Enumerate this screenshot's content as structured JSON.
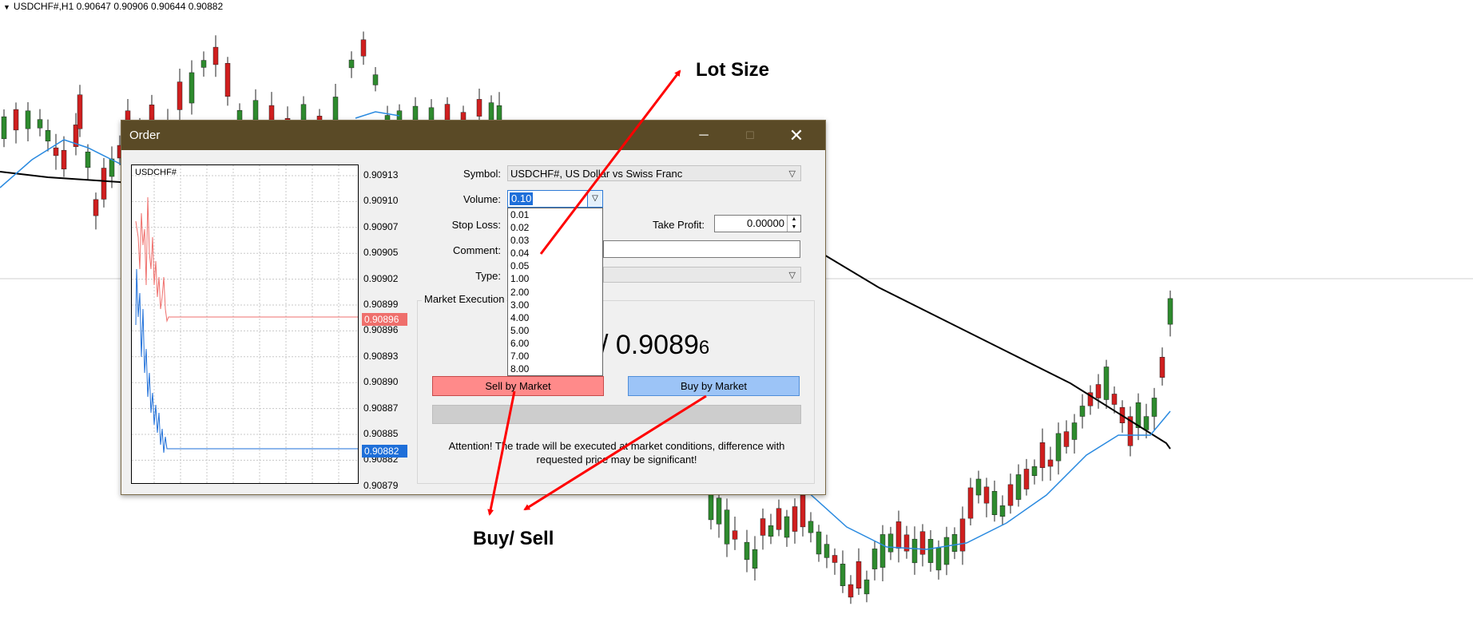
{
  "chart_header": "USDCHF#,H1  0.90647 0.90906 0.90644 0.90882",
  "annotations": {
    "lot_size": "Lot Size",
    "buy_sell": "Buy/ Sell"
  },
  "dialog": {
    "title": "Order",
    "window_buttons": {
      "minimize": "─",
      "maximize": "☐",
      "close": "✕"
    },
    "mini_chart": {
      "symbol": "USDCHF#",
      "ticks": [
        "0.90913",
        "0.90910",
        "0.90907",
        "0.90905",
        "0.90902",
        "0.90899",
        "0.90896",
        "0.90893",
        "0.90890",
        "0.90887",
        "0.90885",
        "0.90882",
        "0.90879"
      ],
      "sell_tag": "0.90896",
      "buy_tag": "0.90882"
    },
    "form": {
      "symbol_label": "Symbol:",
      "symbol_value": "USDCHF#, US Dollar vs Swiss Franc",
      "volume_label": "Volume:",
      "volume_value": "0.10",
      "volume_options": [
        "0.01",
        "0.02",
        "0.03",
        "0.04",
        "0.05",
        "1.00",
        "2.00",
        "3.00",
        "4.00",
        "5.00",
        "6.00",
        "7.00",
        "8.00"
      ],
      "stop_loss_label": "Stop Loss:",
      "take_profit_label": "Take Profit:",
      "take_profit_value": "0.00000",
      "comment_label": "Comment:",
      "type_label": "Type:"
    },
    "execution": {
      "group_title": "Market Execution",
      "price_main": "/ 0.9089",
      "price_small": "6",
      "sell_button": "Sell by Market",
      "buy_button": "Buy by Market",
      "attention": "Attention! The trade will be executed at market conditions, difference with requested price may be significant!"
    }
  },
  "colors": {
    "titlebar": "#5a4a26",
    "sell": "#ff8a8a",
    "buy": "#9cc4f7",
    "arrow": "#ff0000",
    "bull_candle": "#2e8b2e",
    "bear_candle": "#d01f1f"
  }
}
